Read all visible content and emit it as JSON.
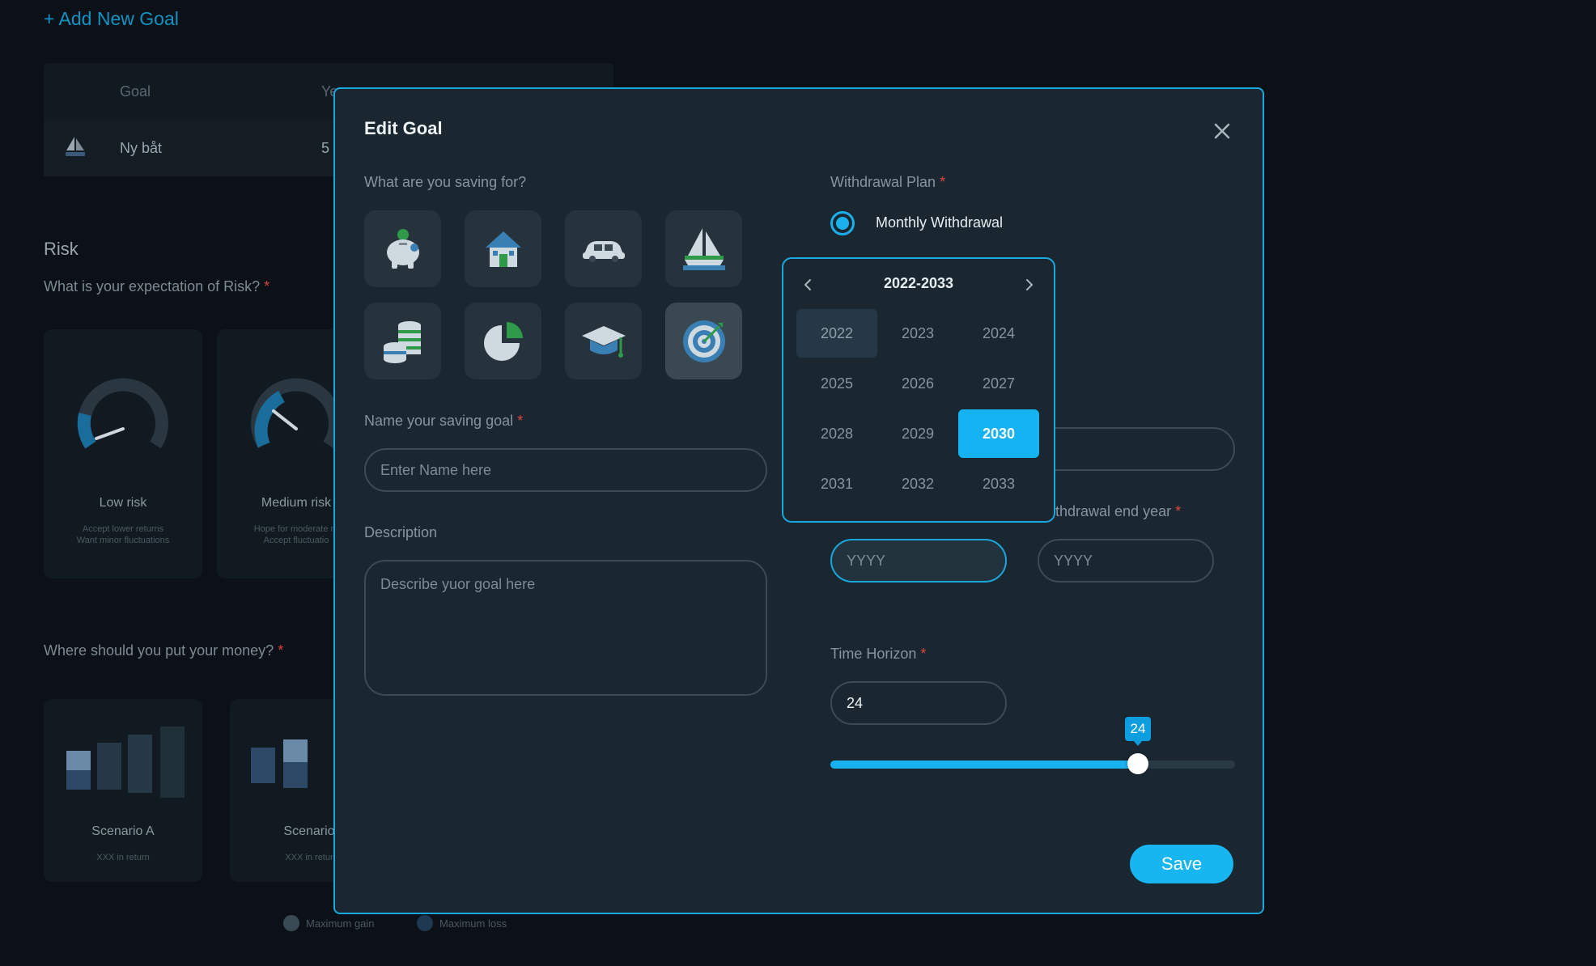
{
  "background": {
    "add_goal_label": "+ Add New Goal",
    "table": {
      "headers": [
        "Goal",
        "Ye"
      ],
      "rows": [
        {
          "goal": "Ny båt",
          "years": "5"
        }
      ]
    },
    "risk": {
      "title": "Risk",
      "question": "What is your expectation of Risk?",
      "required_mark": "*",
      "cards": [
        {
          "name": "Low risk",
          "desc_line1": "Accept lower returns",
          "desc_line2": "Want minor fluctuations"
        },
        {
          "name": "Medium risk",
          "desc_line1": "Hope for moderate re",
          "desc_line2": "Accept fluctuatio"
        }
      ]
    },
    "money": {
      "question": "Where should you put your money?",
      "required_mark": "*",
      "scenarios": [
        {
          "name": "Scenario A",
          "desc": "XXX in return"
        },
        {
          "name": "Scenario",
          "desc": "XXX in retur"
        }
      ]
    },
    "legend": [
      {
        "label": "Maximum gain",
        "color": "#3a4a55"
      },
      {
        "label": "Maximum loss",
        "color": "#1d3a52"
      }
    ]
  },
  "modal": {
    "title": "Edit Goal",
    "saving_for_label": "What are you saving for?",
    "icons": [
      "piggy-bank-icon",
      "house-icon",
      "car-icon",
      "sailboat-icon",
      "coins-icon",
      "pie-chart-icon",
      "graduation-cap-icon",
      "target-icon"
    ],
    "selected_icon": "target-icon",
    "name_label": "Name your saving goal",
    "name_placeholder": "Enter Name here",
    "description_label": "Description",
    "description_placeholder": "Describe yuor goal here",
    "required_mark": "*",
    "withdrawal_plan_label": "Withdrawal Plan",
    "withdrawal_option": "Monthly Withdrawal",
    "withdrawal_end_label": "thdrawal end year",
    "start_year_placeholder": "YYYY",
    "end_year_placeholder": "YYYY",
    "time_horizon_label": "Time Horizon",
    "time_horizon_value": "24",
    "slider": {
      "value": "24",
      "fraction": 0.76
    },
    "save_label": "Save",
    "accent_color": "#19b1ef"
  },
  "year_picker": {
    "range": "2022-2033",
    "years": [
      "2022",
      "2023",
      "2024",
      "2025",
      "2026",
      "2027",
      "2028",
      "2029",
      "2030",
      "2031",
      "2032",
      "2033"
    ],
    "current_year": "2022",
    "selected_year": "2030"
  }
}
